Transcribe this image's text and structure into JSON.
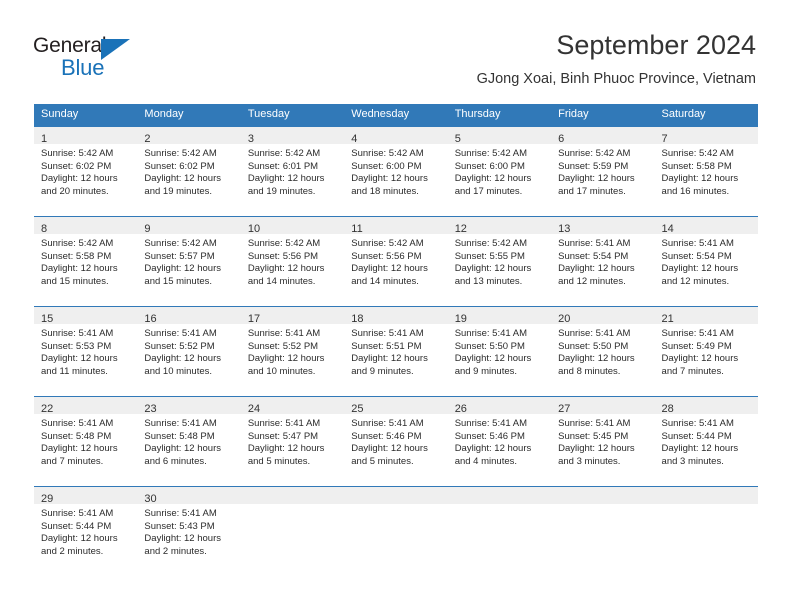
{
  "logo": {
    "word_top": "General",
    "word_bottom": "Blue",
    "triangle_icon": "blue-triangle-icon",
    "colors": {
      "dark": "#231f20",
      "blue": "#1a72b8"
    }
  },
  "header": {
    "title": "September 2024",
    "subtitle": "GJong Xoai, Binh Phuoc Province, Vietnam"
  },
  "theme": {
    "header_blue": "#3179b8",
    "daynum_band": "#efefef",
    "text": "#2b2b2b"
  },
  "calendar": {
    "weekday_headers": [
      "Sunday",
      "Monday",
      "Tuesday",
      "Wednesday",
      "Thursday",
      "Friday",
      "Saturday"
    ],
    "weeks": [
      [
        {
          "day": "1",
          "sunrise": "Sunrise: 5:42 AM",
          "sunset": "Sunset: 6:02 PM",
          "daylight_1": "Daylight: 12 hours",
          "daylight_2": "and 20 minutes."
        },
        {
          "day": "2",
          "sunrise": "Sunrise: 5:42 AM",
          "sunset": "Sunset: 6:02 PM",
          "daylight_1": "Daylight: 12 hours",
          "daylight_2": "and 19 minutes."
        },
        {
          "day": "3",
          "sunrise": "Sunrise: 5:42 AM",
          "sunset": "Sunset: 6:01 PM",
          "daylight_1": "Daylight: 12 hours",
          "daylight_2": "and 19 minutes."
        },
        {
          "day": "4",
          "sunrise": "Sunrise: 5:42 AM",
          "sunset": "Sunset: 6:00 PM",
          "daylight_1": "Daylight: 12 hours",
          "daylight_2": "and 18 minutes."
        },
        {
          "day": "5",
          "sunrise": "Sunrise: 5:42 AM",
          "sunset": "Sunset: 6:00 PM",
          "daylight_1": "Daylight: 12 hours",
          "daylight_2": "and 17 minutes."
        },
        {
          "day": "6",
          "sunrise": "Sunrise: 5:42 AM",
          "sunset": "Sunset: 5:59 PM",
          "daylight_1": "Daylight: 12 hours",
          "daylight_2": "and 17 minutes."
        },
        {
          "day": "7",
          "sunrise": "Sunrise: 5:42 AM",
          "sunset": "Sunset: 5:58 PM",
          "daylight_1": "Daylight: 12 hours",
          "daylight_2": "and 16 minutes."
        }
      ],
      [
        {
          "day": "8",
          "sunrise": "Sunrise: 5:42 AM",
          "sunset": "Sunset: 5:58 PM",
          "daylight_1": "Daylight: 12 hours",
          "daylight_2": "and 15 minutes."
        },
        {
          "day": "9",
          "sunrise": "Sunrise: 5:42 AM",
          "sunset": "Sunset: 5:57 PM",
          "daylight_1": "Daylight: 12 hours",
          "daylight_2": "and 15 minutes."
        },
        {
          "day": "10",
          "sunrise": "Sunrise: 5:42 AM",
          "sunset": "Sunset: 5:56 PM",
          "daylight_1": "Daylight: 12 hours",
          "daylight_2": "and 14 minutes."
        },
        {
          "day": "11",
          "sunrise": "Sunrise: 5:42 AM",
          "sunset": "Sunset: 5:56 PM",
          "daylight_1": "Daylight: 12 hours",
          "daylight_2": "and 14 minutes."
        },
        {
          "day": "12",
          "sunrise": "Sunrise: 5:42 AM",
          "sunset": "Sunset: 5:55 PM",
          "daylight_1": "Daylight: 12 hours",
          "daylight_2": "and 13 minutes."
        },
        {
          "day": "13",
          "sunrise": "Sunrise: 5:41 AM",
          "sunset": "Sunset: 5:54 PM",
          "daylight_1": "Daylight: 12 hours",
          "daylight_2": "and 12 minutes."
        },
        {
          "day": "14",
          "sunrise": "Sunrise: 5:41 AM",
          "sunset": "Sunset: 5:54 PM",
          "daylight_1": "Daylight: 12 hours",
          "daylight_2": "and 12 minutes."
        }
      ],
      [
        {
          "day": "15",
          "sunrise": "Sunrise: 5:41 AM",
          "sunset": "Sunset: 5:53 PM",
          "daylight_1": "Daylight: 12 hours",
          "daylight_2": "and 11 minutes."
        },
        {
          "day": "16",
          "sunrise": "Sunrise: 5:41 AM",
          "sunset": "Sunset: 5:52 PM",
          "daylight_1": "Daylight: 12 hours",
          "daylight_2": "and 10 minutes."
        },
        {
          "day": "17",
          "sunrise": "Sunrise: 5:41 AM",
          "sunset": "Sunset: 5:52 PM",
          "daylight_1": "Daylight: 12 hours",
          "daylight_2": "and 10 minutes."
        },
        {
          "day": "18",
          "sunrise": "Sunrise: 5:41 AM",
          "sunset": "Sunset: 5:51 PM",
          "daylight_1": "Daylight: 12 hours",
          "daylight_2": "and 9 minutes."
        },
        {
          "day": "19",
          "sunrise": "Sunrise: 5:41 AM",
          "sunset": "Sunset: 5:50 PM",
          "daylight_1": "Daylight: 12 hours",
          "daylight_2": "and 9 minutes."
        },
        {
          "day": "20",
          "sunrise": "Sunrise: 5:41 AM",
          "sunset": "Sunset: 5:50 PM",
          "daylight_1": "Daylight: 12 hours",
          "daylight_2": "and 8 minutes."
        },
        {
          "day": "21",
          "sunrise": "Sunrise: 5:41 AM",
          "sunset": "Sunset: 5:49 PM",
          "daylight_1": "Daylight: 12 hours",
          "daylight_2": "and 7 minutes."
        }
      ],
      [
        {
          "day": "22",
          "sunrise": "Sunrise: 5:41 AM",
          "sunset": "Sunset: 5:48 PM",
          "daylight_1": "Daylight: 12 hours",
          "daylight_2": "and 7 minutes."
        },
        {
          "day": "23",
          "sunrise": "Sunrise: 5:41 AM",
          "sunset": "Sunset: 5:48 PM",
          "daylight_1": "Daylight: 12 hours",
          "daylight_2": "and 6 minutes."
        },
        {
          "day": "24",
          "sunrise": "Sunrise: 5:41 AM",
          "sunset": "Sunset: 5:47 PM",
          "daylight_1": "Daylight: 12 hours",
          "daylight_2": "and 5 minutes."
        },
        {
          "day": "25",
          "sunrise": "Sunrise: 5:41 AM",
          "sunset": "Sunset: 5:46 PM",
          "daylight_1": "Daylight: 12 hours",
          "daylight_2": "and 5 minutes."
        },
        {
          "day": "26",
          "sunrise": "Sunrise: 5:41 AM",
          "sunset": "Sunset: 5:46 PM",
          "daylight_1": "Daylight: 12 hours",
          "daylight_2": "and 4 minutes."
        },
        {
          "day": "27",
          "sunrise": "Sunrise: 5:41 AM",
          "sunset": "Sunset: 5:45 PM",
          "daylight_1": "Daylight: 12 hours",
          "daylight_2": "and 3 minutes."
        },
        {
          "day": "28",
          "sunrise": "Sunrise: 5:41 AM",
          "sunset": "Sunset: 5:44 PM",
          "daylight_1": "Daylight: 12 hours",
          "daylight_2": "and 3 minutes."
        }
      ],
      [
        {
          "day": "29",
          "sunrise": "Sunrise: 5:41 AM",
          "sunset": "Sunset: 5:44 PM",
          "daylight_1": "Daylight: 12 hours",
          "daylight_2": "and 2 minutes."
        },
        {
          "day": "30",
          "sunrise": "Sunrise: 5:41 AM",
          "sunset": "Sunset: 5:43 PM",
          "daylight_1": "Daylight: 12 hours",
          "daylight_2": "and 2 minutes."
        },
        {
          "day": "",
          "sunrise": "",
          "sunset": "",
          "daylight_1": "",
          "daylight_2": ""
        },
        {
          "day": "",
          "sunrise": "",
          "sunset": "",
          "daylight_1": "",
          "daylight_2": ""
        },
        {
          "day": "",
          "sunrise": "",
          "sunset": "",
          "daylight_1": "",
          "daylight_2": ""
        },
        {
          "day": "",
          "sunrise": "",
          "sunset": "",
          "daylight_1": "",
          "daylight_2": ""
        },
        {
          "day": "",
          "sunrise": "",
          "sunset": "",
          "daylight_1": "",
          "daylight_2": ""
        }
      ]
    ]
  }
}
